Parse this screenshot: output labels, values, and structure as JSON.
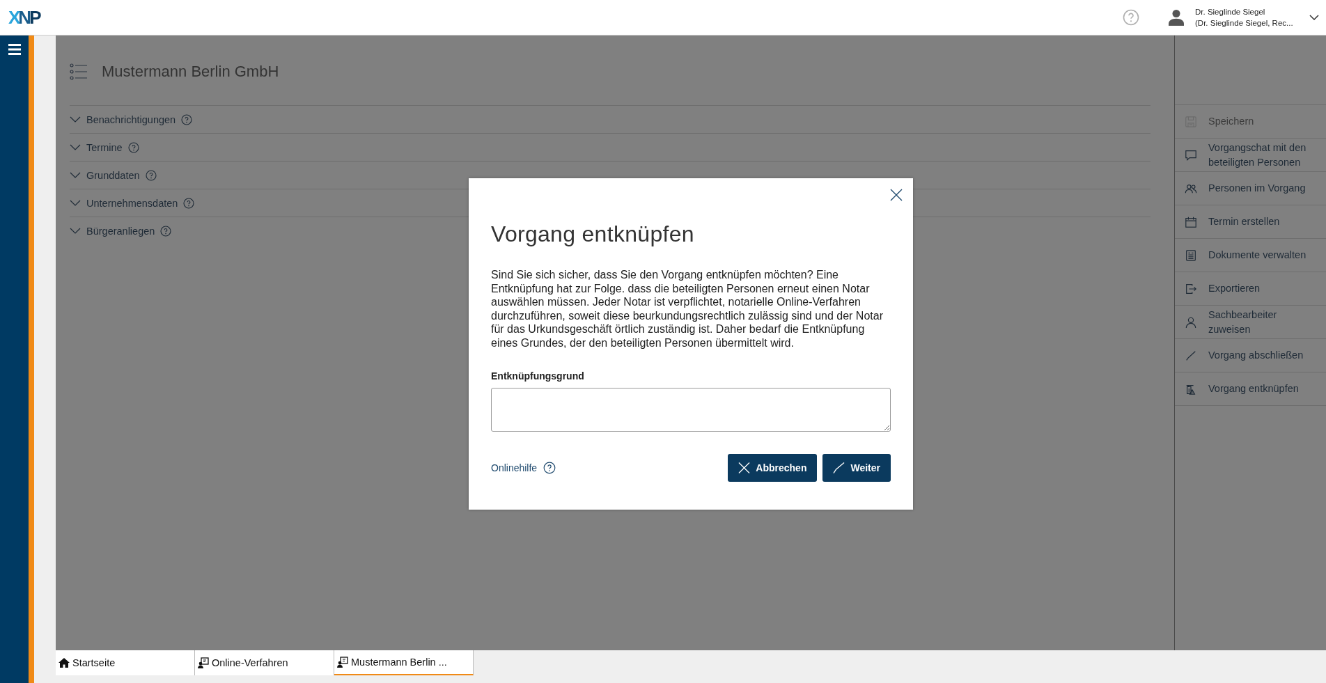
{
  "header": {
    "logo": "XNP",
    "user": {
      "name": "Dr. Sieglinde Siegel",
      "role": "(Dr. Sieglinde Siegel, Rec..."
    }
  },
  "page": {
    "title": "Mustermann Berlin GmbH",
    "sections": [
      {
        "label": "Benachrichtigungen",
        "expanded": false
      },
      {
        "label": "Termine",
        "expanded": false
      },
      {
        "label": "Grunddaten",
        "expanded": false
      },
      {
        "label": "Unternehmensdaten",
        "expanded": false
      },
      {
        "label": "Bürgeranliegen",
        "expanded": false
      }
    ]
  },
  "actions": [
    {
      "kind": "save",
      "label": "Speichern",
      "disabled": true
    },
    {
      "kind": "chat",
      "label": "Vorgangschat mit den beteiligten Personen",
      "disabled": false
    },
    {
      "kind": "people",
      "label": "Personen im Vorgang",
      "disabled": false
    },
    {
      "kind": "calendar",
      "label": "Termin erstellen",
      "disabled": false
    },
    {
      "kind": "document",
      "label": "Dokumente verwalten",
      "disabled": false
    },
    {
      "kind": "export",
      "label": "Exportieren",
      "disabled": false
    },
    {
      "kind": "person",
      "label": "Sachbearbeiter zuweisen",
      "disabled": false
    },
    {
      "kind": "check",
      "label": "Vorgang abschließen",
      "disabled": false
    },
    {
      "kind": "unlink",
      "label": "Vorgang entknüpfen",
      "disabled": false
    }
  ],
  "dialog": {
    "title": "Vorgang entknüpfen",
    "message": "Sind Sie sich sicher, dass Sie den Vorgang entknüpfen möchten? Eine Entknüpfung hat zur Folge. dass die beteiligten Personen erneut einen Notar auswählen müssen. Jeder Notar ist verpflichtet, notarielle Online-Verfahren durchzuführen, soweit diese beurkundungsrechtlich zulässig sind und der Notar für das Urkundsgeschäft örtlich zuständig ist. Daher bedarf die Entknüpfung eines Grundes, der den beteiligten Personen übermittelt wird.",
    "field_label": "Entknüpfungsgrund",
    "help_link": "Onlinehilfe",
    "buttons": [
      {
        "kind": "cancel",
        "label": "Abbrechen"
      },
      {
        "kind": "confirm",
        "label": "Weiter"
      }
    ]
  },
  "bottom_tabs": [
    {
      "kind": "home",
      "label": "Startseite",
      "selected": false
    },
    {
      "kind": "case",
      "label": "Online-Verfahren",
      "selected": false
    },
    {
      "kind": "case",
      "label": "Mustermann Berlin ...",
      "selected": true
    }
  ]
}
